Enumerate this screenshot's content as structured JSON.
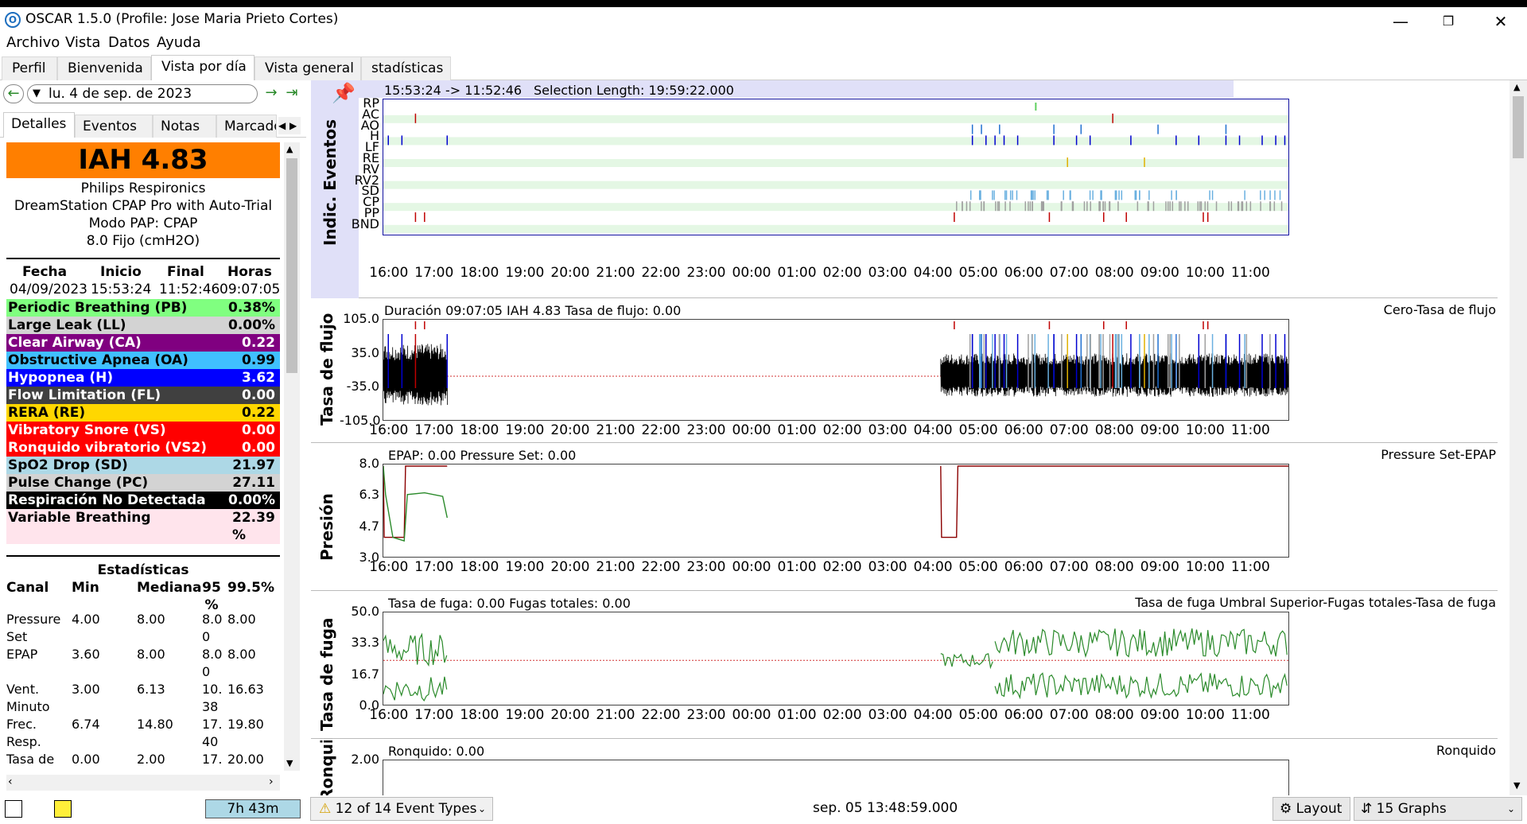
{
  "window": {
    "title": "OSCAR 1.5.0 (Profile: Jose Maria Prieto Cortes)",
    "icon": "oscar-logo-icon"
  },
  "menu": [
    "Archivo",
    "Vista",
    "Datos",
    "Ayuda"
  ],
  "tabs": [
    "Perfil",
    "Bienvenida",
    "Vista por día",
    "Vista general",
    "stadísticas"
  ],
  "date": {
    "value": "lu. 4 de sep. de 2023"
  },
  "left_tabs": [
    "Detalles",
    "Eventos",
    "Notas",
    "Marcado"
  ],
  "summary": {
    "iah": "IAH  4.83",
    "brand": "Philips Respironics",
    "model": "DreamStation CPAP Pro with Auto-Trial",
    "mode": "Modo PAP: CPAP",
    "pressure": "8.0 Fijo (cmH2O)"
  },
  "session": {
    "headers": [
      "Fecha",
      "Inicio",
      "Final",
      "Horas"
    ],
    "values": [
      "04/09/2023",
      "15:53:24",
      "11:52:46",
      "09:07:05"
    ]
  },
  "events": [
    {
      "label": "Periodic Breathing (PB)",
      "value": "0.38%",
      "bg": "#80ff80",
      "fg": "#000"
    },
    {
      "label": "Large Leak (LL)",
      "value": "0.00%",
      "bg": "#d3d3d3",
      "fg": "#000"
    },
    {
      "label": "Clear Airway (CA)",
      "value": "0.22",
      "bg": "#800080",
      "fg": "#fff"
    },
    {
      "label": "Obstructive Apnea (OA)",
      "value": "0.99",
      "bg": "#40c0ff",
      "fg": "#000"
    },
    {
      "label": "Hypopnea (H)",
      "value": "3.62",
      "bg": "#0000ff",
      "fg": "#fff"
    },
    {
      "label": "Flow Limitation (FL)",
      "value": "0.00",
      "bg": "#404040",
      "fg": "#fff"
    },
    {
      "label": "RERA (RE)",
      "value": "0.22",
      "bg": "#ffd700",
      "fg": "#000"
    },
    {
      "label": "Vibratory Snore (VS)",
      "value": "0.00",
      "bg": "#ff0000",
      "fg": "#fff"
    },
    {
      "label": "Ronquido vibratorio (VS2)",
      "value": "0.00",
      "bg": "#ff0000",
      "fg": "#fff"
    },
    {
      "label": "SpO2 Drop (SD)",
      "value": "21.97",
      "bg": "#add8e6",
      "fg": "#000"
    },
    {
      "label": "Pulse Change (PC)",
      "value": "27.11",
      "bg": "#d3d3d3",
      "fg": "#000"
    },
    {
      "label": "Respiración No Detectada",
      "value": "0.00%",
      "bg": "#000000",
      "fg": "#fff"
    },
    {
      "label": "Variable Breathing",
      "value": "22.39 %",
      "bg": "#ffe4ec",
      "fg": "#000"
    }
  ],
  "stats": {
    "title": "Estadísticas",
    "headers": [
      "Canal",
      "Min",
      "Mediana",
      "95 %",
      "99.5%"
    ],
    "rows": [
      [
        "Pressure Set",
        "4.00",
        "8.00",
        "8.00",
        "8.00"
      ],
      [
        "EPAP",
        "3.60",
        "8.00",
        "8.00",
        "8.00"
      ],
      [
        "Vent. Minuto",
        "3.00",
        "6.13",
        "10.38",
        "16.63"
      ],
      [
        "Frec. Resp.",
        "6.74",
        "14.80",
        "17.40",
        "19.80"
      ],
      [
        "Tasa de",
        "0.00",
        "2.00",
        "17.",
        "20.00"
      ]
    ]
  },
  "left_bottom": {
    "duration": "7h 43m"
  },
  "time_ticks": [
    "16:00",
    "17:00",
    "18:00",
    "19:00",
    "20:00",
    "21:00",
    "22:00",
    "23:00",
    "00:00",
    "01:00",
    "02:00",
    "03:00",
    "04:00",
    "05:00",
    "06:00",
    "07:00",
    "08:00",
    "09:00",
    "10:00",
    "11:00"
  ],
  "events_graph": {
    "ylabel": "Indic. Eventos",
    "range": "15:53:24 -> 11:52:46",
    "selection": "Selection Length: 19:59:22.000",
    "channels": [
      "RP",
      "AC",
      "AO",
      "H",
      "LF",
      "RE",
      "RV",
      "RV2",
      "SD",
      "CP",
      "PP",
      "BND"
    ],
    "icon": "pushpin-icon"
  },
  "flow_graph": {
    "ylabel": "Tasa de flujo",
    "header": "Duración 09:07:05 IAH 4.83 Tasa de flujo: 0.00",
    "legend": "Cero-Tasa de flujo",
    "yticks": [
      "105.0",
      "35.0",
      "-35.0",
      "-105.0"
    ]
  },
  "pressure_graph": {
    "ylabel": "Presión",
    "header": "EPAP: 0.00 Pressure Set: 0.00",
    "legend": "Pressure Set-EPAP",
    "yticks": [
      "8.0",
      "6.3",
      "4.7",
      "3.0"
    ]
  },
  "leak_graph": {
    "ylabel": "Tasa de fuga",
    "header": "Tasa de fuga: 0.00 Fugas totales: 0.00",
    "legend": "Tasa de fuga Umbral Superior-Fugas totales-Tasa de fuga",
    "yticks": [
      "50.0",
      "33.3",
      "16.7",
      "0.0"
    ]
  },
  "snore_graph": {
    "ylabel": "Ronquido",
    "header": "Ronquido: 0.00",
    "legend": "Ronquido",
    "yticks": [
      "2.00"
    ]
  },
  "statusbar": {
    "event_types": "12 of 14 Event Types",
    "time": "sep. 05 13:48:59.000",
    "layout": "Layout",
    "graphs": "15 Graphs"
  }
}
